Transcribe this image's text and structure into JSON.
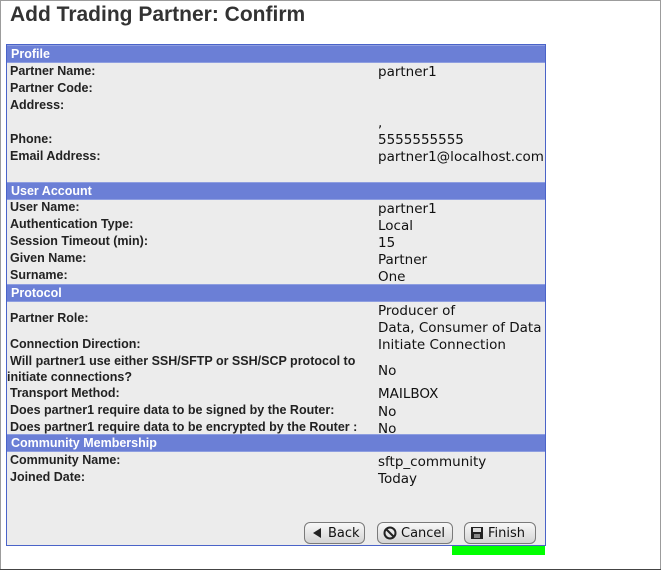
{
  "page": {
    "title": "Add Trading Partner: Confirm"
  },
  "profile": {
    "header": "Profile",
    "rows": [
      {
        "label": "Partner Name:",
        "value": "partner1"
      },
      {
        "label": "Partner Code:",
        "value": ""
      },
      {
        "label": "Address:",
        "value": ""
      },
      {
        "label": "",
        "value": ","
      },
      {
        "label": "Phone:",
        "value": "5555555555"
      },
      {
        "label": "Email Address:",
        "value": "partner1@localhost.com"
      }
    ]
  },
  "user_account": {
    "header": "User Account",
    "rows": [
      {
        "label": "User Name:",
        "value": "partner1"
      },
      {
        "label": "Authentication Type:",
        "value": "Local"
      },
      {
        "label": "Session Timeout (min):",
        "value": "15"
      },
      {
        "label": "Given Name:",
        "value": "Partner"
      },
      {
        "label": "Surname:",
        "value": "One"
      }
    ]
  },
  "protocol": {
    "header": "Protocol",
    "rows": [
      {
        "label": "Partner Role:",
        "value_line1": "Producer of",
        "value_line2": "Data, Consumer of Data"
      },
      {
        "label": "Connection Direction:",
        "value": "Initiate Connection"
      },
      {
        "label_line1": "Will partner1 use either SSH/SFTP or SSH/SCP protocol to",
        "label_line2": "initiate connections?",
        "value": "No"
      },
      {
        "label": "Transport Method:",
        "value": "MAILBOX"
      },
      {
        "label": "Does partner1 require data to be signed by the Router:",
        "value": "No"
      },
      {
        "label": "Does partner1 require data to be encrypted by the Router :",
        "value": "No"
      }
    ]
  },
  "community": {
    "header": "Community Membership",
    "rows": [
      {
        "label": "Community Name:",
        "value": "sftp_community"
      },
      {
        "label": "Joined Date:",
        "value": "Today"
      }
    ]
  },
  "buttons": {
    "back": "Back",
    "cancel": "Cancel",
    "finish": "Finish"
  },
  "colors": {
    "section_header": "#6b7fd6",
    "panel_bg": "#ececec",
    "highlight": "#00ff00"
  }
}
